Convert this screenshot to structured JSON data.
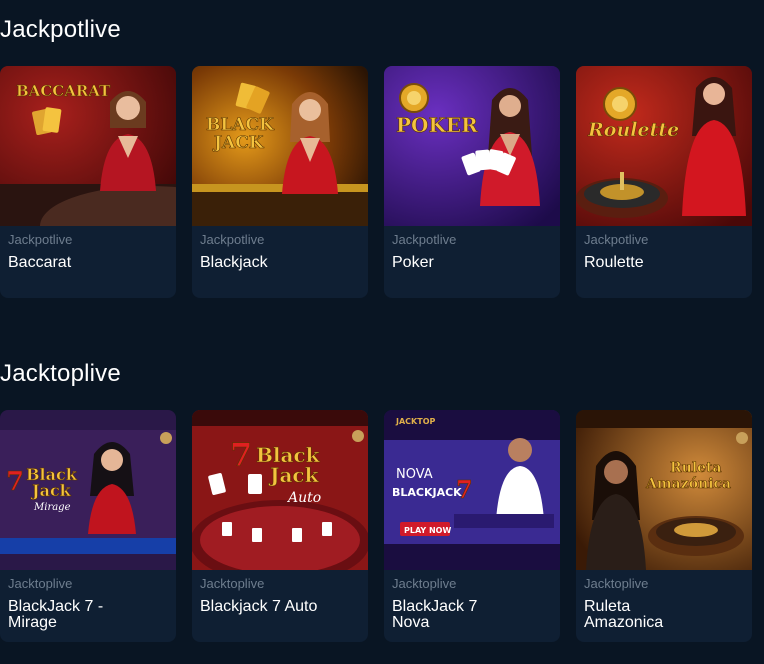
{
  "sections": [
    {
      "title": "Jackpotlive",
      "games": [
        {
          "provider": "Jackpotlive",
          "name": "Baccarat",
          "thumb_title": "BACCARAT"
        },
        {
          "provider": "Jackpotlive",
          "name": "Blackjack",
          "thumb_title": "BLACK",
          "thumb_title2": "JACK"
        },
        {
          "provider": "Jackpotlive",
          "name": "Poker",
          "thumb_title": "POKER"
        },
        {
          "provider": "Jackpotlive",
          "name": "Roulette",
          "thumb_title": "Roulette"
        }
      ]
    },
    {
      "title": "Jacktoplive",
      "games": [
        {
          "provider": "Jacktoplive",
          "name": "BlackJack 7 -\nMirage",
          "thumb_title": "Black",
          "thumb_title2": "Jack",
          "thumb_sub": "Mirage",
          "thumb_num": "7"
        },
        {
          "provider": "Jacktoplive",
          "name": "Blackjack 7 Auto",
          "thumb_title": "Black",
          "thumb_title2": "Jack",
          "thumb_sub": "Auto",
          "thumb_num": "7"
        },
        {
          "provider": "Jacktoplive",
          "name": "BlackJack 7\nNova",
          "thumb_title": "NOVA",
          "thumb_title2": "BLACKJACK",
          "thumb_num": "7",
          "thumb_badge": "PLAY NOW",
          "thumb_brand": "JACKTOP"
        },
        {
          "provider": "Jacktoplive",
          "name": "Ruleta\nAmazonica",
          "thumb_title": "Ruleta",
          "thumb_title2": "Amazónica"
        }
      ]
    }
  ],
  "colors": {
    "background": "#091523",
    "card": "#0f1f33",
    "provider_text": "#6e7d8e",
    "gold": "#f4c33f"
  }
}
